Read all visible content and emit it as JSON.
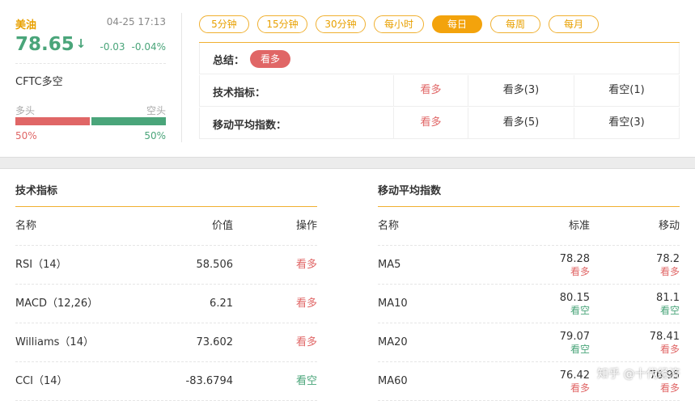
{
  "asset": {
    "name": "美油",
    "time": "04-25 17:13",
    "price": "78.65",
    "arrow": "↓",
    "change": "-0.03",
    "change_pct": "-0.04%",
    "cftc_label": "CFTC多空",
    "bull_label": "多头",
    "bear_label": "空头",
    "bull_pct": "50%",
    "bear_pct": "50%",
    "bull_fraction": 0.5
  },
  "tabs": [
    {
      "label": "5分钟",
      "active": false
    },
    {
      "label": "15分钟",
      "active": false
    },
    {
      "label": "30分钟",
      "active": false
    },
    {
      "label": "每小时",
      "active": false
    },
    {
      "label": "每日",
      "active": true
    },
    {
      "label": "每周",
      "active": false
    },
    {
      "label": "每月",
      "active": false
    }
  ],
  "summary": {
    "label": "总结：",
    "verdict": "看多",
    "rows": [
      {
        "label": "技术指标：",
        "verdict": "看多",
        "bull": "看多(3)",
        "bear": "看空(1)"
      },
      {
        "label": "移动平均指数：",
        "verdict": "看多",
        "bull": "看多(5)",
        "bear": "看空(3)"
      }
    ]
  },
  "tech": {
    "title": "技术指标",
    "headers": {
      "name": "名称",
      "value": "价值",
      "action": "操作"
    },
    "rows": [
      {
        "name": "RSI（14）",
        "value": "58.506",
        "action": "看多",
        "signal": "bull"
      },
      {
        "name": "MACD（12,26）",
        "value": "6.21",
        "action": "看多",
        "signal": "bull"
      },
      {
        "name": "Williams（14）",
        "value": "73.602",
        "action": "看多",
        "signal": "bull"
      },
      {
        "name": "CCI（14）",
        "value": "-83.6794",
        "action": "看空",
        "signal": "bear"
      }
    ]
  },
  "ma": {
    "title": "移动平均指数",
    "headers": {
      "name": "名称",
      "standard": "标准",
      "moving": "移动"
    },
    "rows": [
      {
        "name": "MA5",
        "std": "78.28",
        "std_sig": "看多",
        "std_signal": "bull",
        "mov": "78.2",
        "mov_sig": "看多",
        "mov_signal": "bull"
      },
      {
        "name": "MA10",
        "std": "80.15",
        "std_sig": "看空",
        "std_signal": "bear",
        "mov": "81.1",
        "mov_sig": "看空",
        "mov_signal": "bear"
      },
      {
        "name": "MA20",
        "std": "79.07",
        "std_sig": "看空",
        "std_signal": "bear",
        "mov": "78.41",
        "mov_sig": "看多",
        "mov_signal": "bull"
      },
      {
        "name": "MA60",
        "std": "76.42",
        "std_sig": "看多",
        "std_signal": "bull",
        "mov": "76.95",
        "mov_sig": "看多",
        "mov_signal": "bull"
      }
    ]
  },
  "watermark": "知乎 @十代经济"
}
